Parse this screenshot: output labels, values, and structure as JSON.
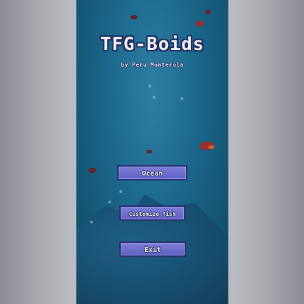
{
  "game": {
    "title": "TFG-Boids",
    "subtitle": "by Peru Monterola"
  },
  "menu": {
    "ocean_label": "Ocean",
    "customize_label": "Customize fish",
    "exit_label": "Exit"
  }
}
